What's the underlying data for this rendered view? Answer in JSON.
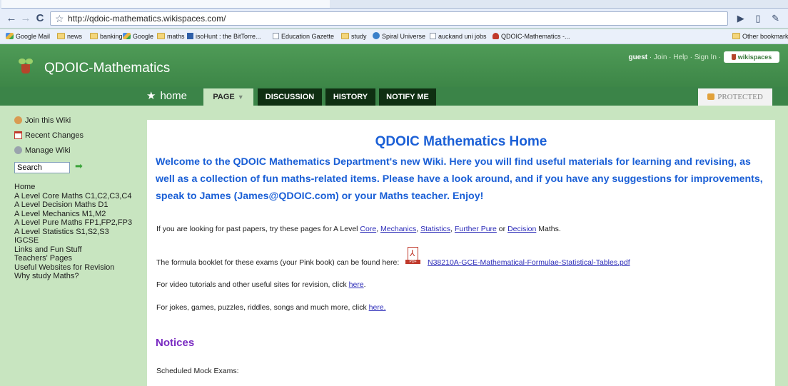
{
  "browser": {
    "url": "http://qdoic-mathematics.wikispaces.com/",
    "back_glyph": "←",
    "forward_glyph": "→",
    "reload_glyph": "C",
    "star_glyph": "☆",
    "bookmarks": [
      {
        "label": "Google Mail",
        "icon": "gmail"
      },
      {
        "label": "news",
        "icon": "folder"
      },
      {
        "label": "banking",
        "icon": "folder"
      },
      {
        "label": "Google",
        "icon": "gmail"
      },
      {
        "label": "maths",
        "icon": "folder"
      },
      {
        "label": "isoHunt : the BitTorre...",
        "icon": "isohunt"
      },
      {
        "label": "Education Gazette",
        "icon": "page"
      },
      {
        "label": "study",
        "icon": "folder"
      },
      {
        "label": "Spiral Universe",
        "icon": "spiral"
      },
      {
        "label": "auckand uni jobs",
        "icon": "page"
      },
      {
        "label": "QDOIC-Mathematics -...",
        "icon": "plant"
      }
    ],
    "other_bookmarks": "Other bookmarks"
  },
  "wiki": {
    "title": "QDOIC-Mathematics",
    "user": "guest",
    "user_links": [
      "Join",
      "Help",
      "Sign In"
    ],
    "badge": "wikispaces",
    "home": "home",
    "tabs": [
      "PAGE",
      "DISCUSSION",
      "HISTORY",
      "NOTIFY ME"
    ],
    "protected": "PROTECTED"
  },
  "sidebar": {
    "actions": [
      "Join this Wiki",
      "Recent Changes",
      "Manage Wiki"
    ],
    "search_value": "Search",
    "nav": [
      "Home",
      "A Level Core Maths C1,C2,C3,C4",
      "A Level Decision Maths D1",
      "A Level Mechanics M1,M2",
      "A Level Pure Maths FP1,FP2,FP3",
      "A Level Statistics S1,S2,S3",
      "IGCSE",
      "Links and Fun Stuff",
      "Teachers' Pages",
      "Useful Websites for Revision",
      "Why study Maths?"
    ]
  },
  "content": {
    "title": "QDOIC Mathematics Home",
    "welcome": "Welcome to the QDOIC Mathematics Department's new Wiki. Here you will find useful materials for learning and revising, as well as a collection of fun maths-related items. Please have a look around, and if you have any suggestions for improvements, speak to James (James@QDOIC.com) or your Maths teacher. Enjoy!",
    "past_papers": {
      "prefix": "If you are looking for past papers, try these pages for A Level ",
      "core": "Core",
      "sep1": ", ",
      "mechanics": "Mechanics",
      "sep2": ", ",
      "statistics": "Statistics",
      "sep3": ", ",
      "further": "Further Pure",
      "or": " or ",
      "decision": "Decision",
      "suffix": " Maths."
    },
    "formula": {
      "prefix": "The formula booklet for these exams (your Pink book) can be found here:",
      "file": "N38210A-GCE-Mathematical-Formulae-Statistical-Tables.pdf"
    },
    "video": {
      "prefix": "For video tutorials and other useful sites for revision, click ",
      "link": "here",
      "suffix": "."
    },
    "jokes": {
      "prefix": "For jokes, games, puzzles, riddles, songs and much more, click ",
      "link": "here."
    },
    "notices_heading": "Notices",
    "scheduled": "Scheduled Mock Exams:"
  }
}
